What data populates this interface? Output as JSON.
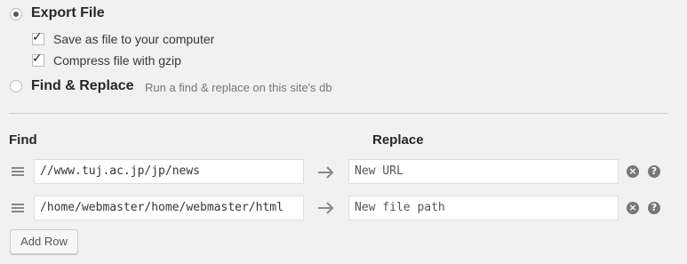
{
  "export_option": {
    "title": "Export File",
    "selected": true,
    "save_as_file": {
      "label": "Save as file to your computer",
      "checked": true
    },
    "compress": {
      "label": "Compress file with gzip",
      "checked": true
    }
  },
  "replace_option": {
    "title": "Find & Replace",
    "description": "Run a find & replace on this site's db",
    "selected": false
  },
  "table": {
    "find_header": "Find",
    "replace_header": "Replace",
    "rows": [
      {
        "find_value": "//www.tuj.ac.jp/jp/news",
        "replace_placeholder": "New URL"
      },
      {
        "find_value": "/home/webmaster/home/webmaster/html",
        "replace_placeholder": "New file path"
      }
    ]
  },
  "icons": {
    "check": "✓",
    "arrow": "arrow-right-icon",
    "remove": "×",
    "help": "?"
  },
  "add_row_label": "Add Row"
}
